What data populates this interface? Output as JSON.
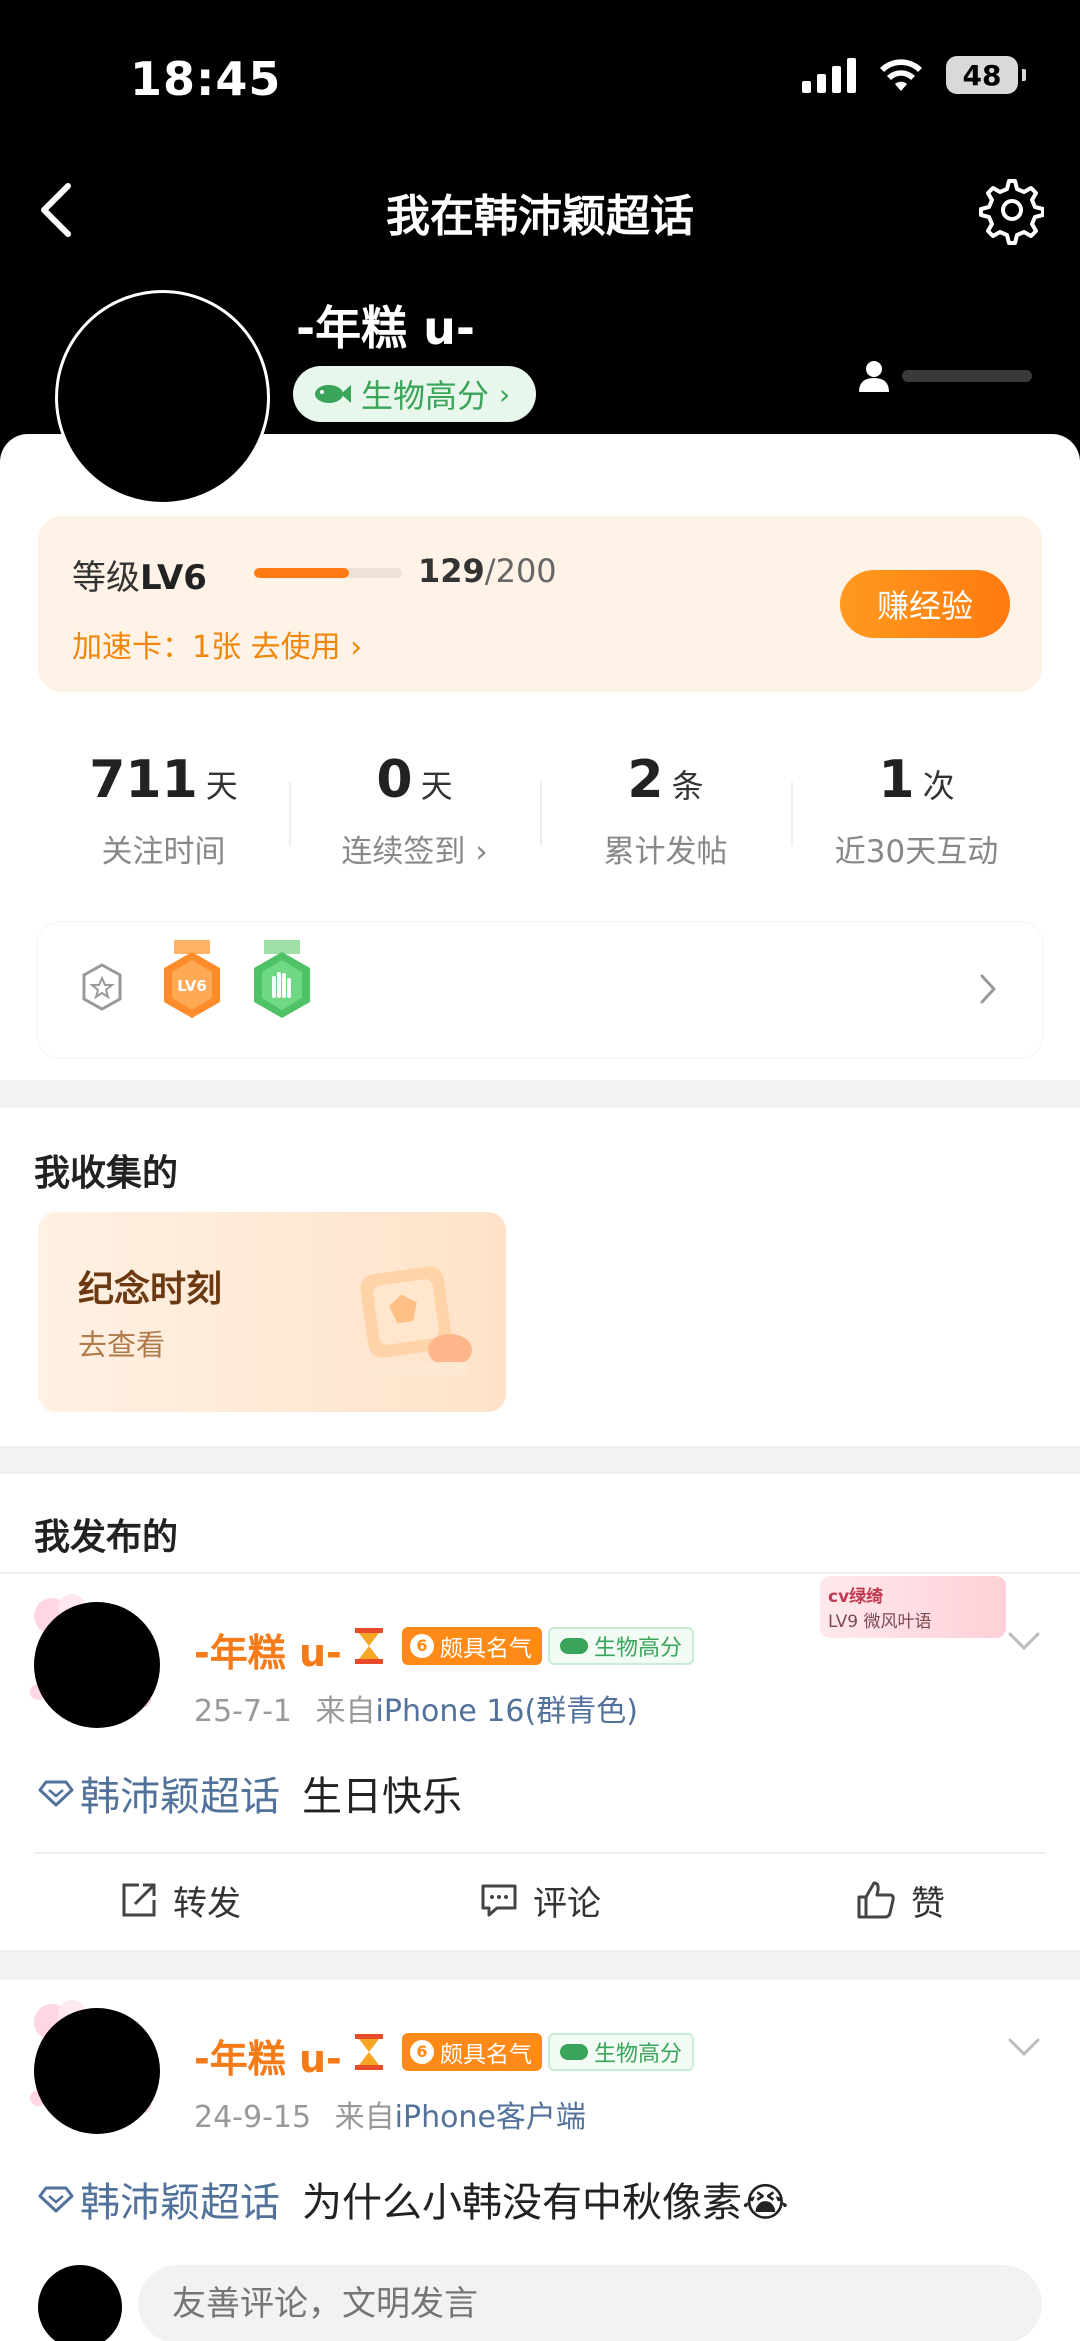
{
  "status_bar": {
    "time": "18:45",
    "battery": "48"
  },
  "header": {
    "title": "我在韩沛颖超话"
  },
  "profile": {
    "username": "-年糕 u-",
    "tag": "生物高分"
  },
  "level": {
    "label": "等级",
    "level": "LV6",
    "current": "129",
    "total": "/200",
    "progress": 0.645,
    "speed_card": "加速卡：1张 去使用",
    "earn_button": "赚经验"
  },
  "stats": [
    {
      "value": "711",
      "unit": "天",
      "label": "关注时间"
    },
    {
      "value": "0",
      "unit": "天",
      "label": "连续签到"
    },
    {
      "value": "2",
      "unit": "条",
      "label": "累计发帖"
    },
    {
      "value": "1",
      "unit": "次",
      "label": "近30天互动"
    }
  ],
  "badges": [
    {
      "icon": "badge-outline-icon"
    },
    {
      "icon": "lv6-medal-icon",
      "text": "LV6"
    },
    {
      "icon": "green-hand-medal-icon"
    }
  ],
  "collection": {
    "title": "我收集的",
    "card_title": "纪念时刻",
    "card_sub": "去查看"
  },
  "posts_section": {
    "title": "我发布的"
  },
  "posts": [
    {
      "name": "-年糕 u-",
      "vip": "颇具名气",
      "bio": "生物高分",
      "date": "25-7-1",
      "from": "来自",
      "device": "iPhone 16(群青色)",
      "topic": "韩沛颖超话",
      "text": "生日快乐",
      "sticker_title": "cv绿绮",
      "sticker_sub": "LV9 微风叶语",
      "actions": {
        "forward": "转发",
        "comment": "评论",
        "like": "赞"
      }
    },
    {
      "name": "-年糕 u-",
      "vip": "颇具名气",
      "bio": "生物高分",
      "date": "24-9-15",
      "from": "来自",
      "device": "iPhone客户端",
      "topic": "韩沛颖超话",
      "text": "为什么小韩没有中秋像素😭"
    }
  ],
  "comment": {
    "placeholder": "友善评论，文明发言"
  },
  "colors": {
    "accent": "#ff7a12",
    "green": "#3aa45a",
    "link": "#53729b"
  }
}
